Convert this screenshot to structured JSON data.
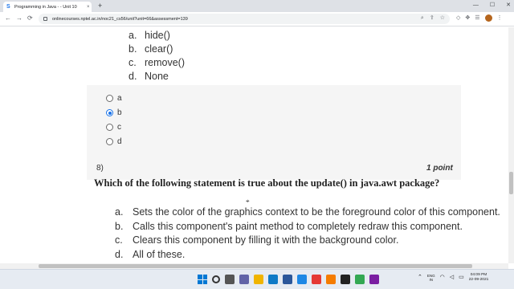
{
  "browser": {
    "tab_favicon": "S",
    "tab_title": "Programming in Java - - Unit 10",
    "tab_close": "×",
    "new_tab": "+",
    "window_controls": {
      "minimize": "—",
      "maximize": "☐",
      "close": "✕"
    },
    "url": "onlinecourses.nptel.ac.in/noc21_cs56/unit?unit=66&assessment=139",
    "nav": {
      "back": "←",
      "forward": "→",
      "reload": "⟳"
    }
  },
  "previous_question": {
    "options": [
      {
        "letter": "a.",
        "text": "hide()"
      },
      {
        "letter": "b.",
        "text": "clear()"
      },
      {
        "letter": "c.",
        "text": "remove()"
      },
      {
        "letter": "d.",
        "text": "None"
      }
    ],
    "answers": [
      {
        "label": "a",
        "selected": false
      },
      {
        "label": "b",
        "selected": true
      },
      {
        "label": "c",
        "selected": false
      },
      {
        "label": "d",
        "selected": false
      }
    ]
  },
  "question": {
    "number": "8)",
    "points": "1 point",
    "text": "Which of the following statement is true about the update() in java.awt package?",
    "options": [
      {
        "letter": "a.",
        "text": "Sets the color of the graphics context to be the foreground color of this component."
      },
      {
        "letter": "b.",
        "text": "Calls this component's paint method to completely redraw this component."
      },
      {
        "letter": "c.",
        "text": "Clears this component by filling it with the background color."
      },
      {
        "letter": "d.",
        "text": "All of these."
      }
    ]
  },
  "taskbar": {
    "lang_line1": "ENG",
    "lang_line2": "IN",
    "time": "04:09 PM",
    "date": "22-09-2021"
  },
  "colors": {
    "accent": "#1a73e8",
    "taskbar": "#e6ebf2",
    "radio_panel": "#f5f5f5"
  }
}
